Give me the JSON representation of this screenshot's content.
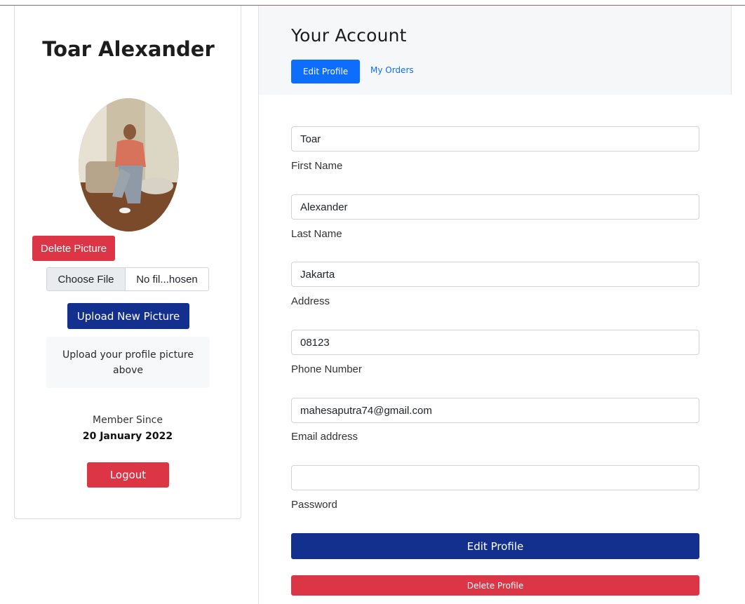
{
  "profile": {
    "name": "Toar Alexander",
    "delete_picture_label": "Delete Picture",
    "choose_file_label": "Choose File",
    "file_name": "No fil...hosen",
    "upload_label": "Upload New Picture",
    "upload_hint": "Upload your profile picture above",
    "member_since_label": "Member Since",
    "member_since_date": "20 January 2022",
    "logout_label": "Logout"
  },
  "account": {
    "title": "Your Account",
    "tabs": [
      {
        "label": "Edit Profile",
        "active": true
      },
      {
        "label": "My Orders",
        "active": false
      }
    ],
    "fields": [
      {
        "label": "First Name",
        "value": ""
      },
      {
        "label": "Last Name",
        "value": ""
      },
      {
        "label": "Address",
        "value": ""
      },
      {
        "label": "Phone Number",
        "value": ""
      },
      {
        "label": "Email address",
        "value": ""
      },
      {
        "label": "Password",
        "value": ""
      }
    ],
    "field_values": [
      "Toar",
      "Alexander",
      "Jakarta",
      "08123",
      "mahesaputra74@gmail.com",
      ""
    ],
    "edit_profile_label": "Edit Profile",
    "delete_profile_label": "Delete Profile"
  },
  "colors": {
    "primary": "#0d6efd",
    "navy": "#14308f",
    "danger": "#dc3545"
  }
}
